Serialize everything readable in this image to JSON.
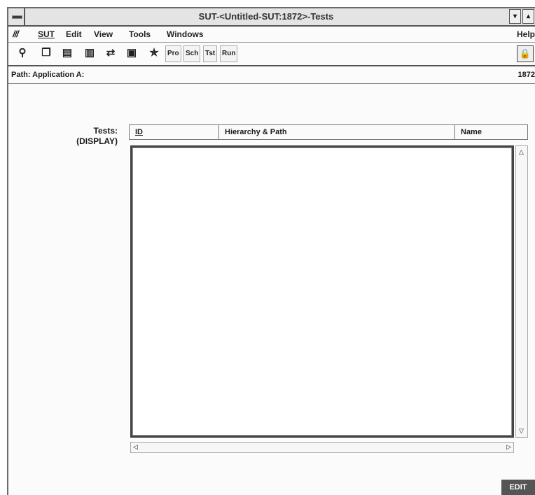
{
  "window": {
    "title": "SUT-<Untitled-SUT:1872>-Tests",
    "minimize_glyph": "▾",
    "maximize_glyph": "▴"
  },
  "menubar": {
    "logo": "///",
    "items": [
      "SUT",
      "Edit",
      "View",
      "Tools",
      "Windows"
    ],
    "help": "Help"
  },
  "toolbar": {
    "icons": [
      "attach-icon",
      "copy-icon",
      "paste-icon",
      "building-icon",
      "refresh-icon",
      "save-icon",
      "run-icon"
    ],
    "text_buttons": [
      "Pro",
      "Sch",
      "Tst",
      "Run"
    ],
    "lock_icon": "lock-icon"
  },
  "pathbar": {
    "label": "Path: Application A:",
    "id": "1872"
  },
  "field": {
    "label_line1": "Tests:",
    "label_line2": "(DISPLAY)"
  },
  "table": {
    "columns": [
      "ID",
      "Hierarchy & Path",
      "Name"
    ],
    "rows": []
  },
  "status": {
    "mode": "EDIT"
  }
}
